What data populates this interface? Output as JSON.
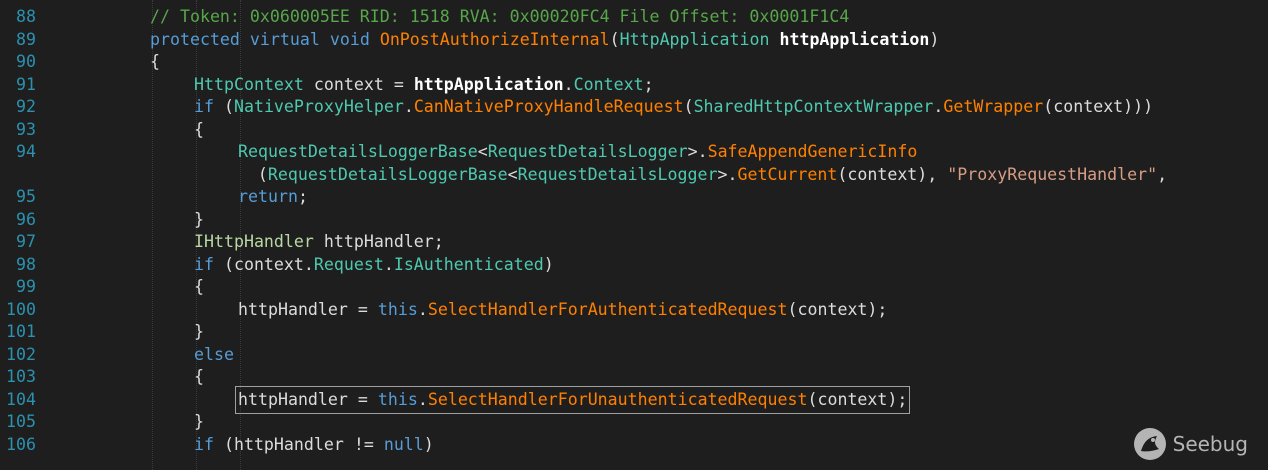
{
  "lines": [
    {
      "num": "88",
      "indent": 3,
      "tokens": [
        {
          "t": "// Token: 0x060005EE RID: 1518 RVA: 0x00020FC4 File Offset: 0x0001F1C4",
          "c": "comment"
        }
      ]
    },
    {
      "num": "89",
      "indent": 3,
      "tokens": [
        {
          "t": "protected",
          "c": "kw"
        },
        {
          "t": " ",
          "c": "plain"
        },
        {
          "t": "virtual",
          "c": "kw"
        },
        {
          "t": " ",
          "c": "plain"
        },
        {
          "t": "void",
          "c": "kw"
        },
        {
          "t": " ",
          "c": "plain"
        },
        {
          "t": "OnPostAuthorizeInternal",
          "c": "method"
        },
        {
          "t": "(",
          "c": "plain"
        },
        {
          "t": "HttpApplication",
          "c": "type"
        },
        {
          "t": " ",
          "c": "plain"
        },
        {
          "t": "httpApplication",
          "c": "bold"
        },
        {
          "t": ")",
          "c": "plain"
        }
      ]
    },
    {
      "num": "90",
      "indent": 3,
      "tokens": [
        {
          "t": "{",
          "c": "plain"
        }
      ]
    },
    {
      "num": "91",
      "indent": 4,
      "tokens": [
        {
          "t": "HttpContext",
          "c": "type"
        },
        {
          "t": " context = ",
          "c": "plain"
        },
        {
          "t": "httpApplication",
          "c": "bold"
        },
        {
          "t": ".",
          "c": "plain"
        },
        {
          "t": "Context",
          "c": "prop"
        },
        {
          "t": ";",
          "c": "plain"
        }
      ]
    },
    {
      "num": "92",
      "indent": 4,
      "tokens": [
        {
          "t": "if",
          "c": "kw"
        },
        {
          "t": " (",
          "c": "plain"
        },
        {
          "t": "NativeProxyHelper",
          "c": "type"
        },
        {
          "t": ".",
          "c": "plain"
        },
        {
          "t": "CanNativeProxyHandleRequest",
          "c": "method"
        },
        {
          "t": "(",
          "c": "plain"
        },
        {
          "t": "SharedHttpContextWrapper",
          "c": "type"
        },
        {
          "t": ".",
          "c": "plain"
        },
        {
          "t": "GetWrapper",
          "c": "method"
        },
        {
          "t": "(context)))",
          "c": "plain"
        }
      ]
    },
    {
      "num": "93",
      "indent": 4,
      "tokens": [
        {
          "t": "{",
          "c": "plain"
        }
      ]
    },
    {
      "num": "94",
      "indent": 5,
      "tokens": [
        {
          "t": "RequestDetailsLoggerBase",
          "c": "type"
        },
        {
          "t": "<",
          "c": "plain"
        },
        {
          "t": "RequestDetailsLogger",
          "c": "type"
        },
        {
          "t": ">.",
          "c": "plain"
        },
        {
          "t": "SafeAppendGenericInfo",
          "c": "method"
        }
      ]
    },
    {
      "num": "",
      "indent": 5,
      "extra": 2,
      "tokens": [
        {
          "t": "(",
          "c": "plain"
        },
        {
          "t": "RequestDetailsLoggerBase",
          "c": "type"
        },
        {
          "t": "<",
          "c": "plain"
        },
        {
          "t": "RequestDetailsLogger",
          "c": "type"
        },
        {
          "t": ">.",
          "c": "plain"
        },
        {
          "t": "GetCurrent",
          "c": "method"
        },
        {
          "t": "(context), ",
          "c": "plain"
        },
        {
          "t": "\"ProxyRequestHandler\"",
          "c": "str"
        },
        {
          "t": ",",
          "c": "plain"
        }
      ]
    },
    {
      "num": "95",
      "indent": 5,
      "tokens": [
        {
          "t": "return",
          "c": "kw"
        },
        {
          "t": ";",
          "c": "plain"
        }
      ]
    },
    {
      "num": "96",
      "indent": 4,
      "tokens": [
        {
          "t": "}",
          "c": "plain"
        }
      ]
    },
    {
      "num": "97",
      "indent": 4,
      "tokens": [
        {
          "t": "IHttpHandler",
          "c": "iface"
        },
        {
          "t": " httpHandler;",
          "c": "plain"
        }
      ]
    },
    {
      "num": "98",
      "indent": 4,
      "tokens": [
        {
          "t": "if",
          "c": "kw"
        },
        {
          "t": " (context.",
          "c": "plain"
        },
        {
          "t": "Request",
          "c": "prop"
        },
        {
          "t": ".",
          "c": "plain"
        },
        {
          "t": "IsAuthenticated",
          "c": "prop"
        },
        {
          "t": ")",
          "c": "plain"
        }
      ]
    },
    {
      "num": "99",
      "indent": 4,
      "tokens": [
        {
          "t": "{",
          "c": "plain"
        }
      ]
    },
    {
      "num": "100",
      "indent": 5,
      "tokens": [
        {
          "t": "httpHandler = ",
          "c": "plain"
        },
        {
          "t": "this",
          "c": "kw"
        },
        {
          "t": ".",
          "c": "plain"
        },
        {
          "t": "SelectHandlerForAuthenticatedRequest",
          "c": "method"
        },
        {
          "t": "(context);",
          "c": "plain"
        }
      ]
    },
    {
      "num": "101",
      "indent": 4,
      "tokens": [
        {
          "t": "}",
          "c": "plain"
        }
      ]
    },
    {
      "num": "102",
      "indent": 4,
      "tokens": [
        {
          "t": "else",
          "c": "kw"
        }
      ]
    },
    {
      "num": "103",
      "indent": 4,
      "tokens": [
        {
          "t": "{",
          "c": "plain"
        }
      ]
    },
    {
      "num": "104",
      "indent": 5,
      "boxed": true,
      "tokens": [
        {
          "t": "httpHandler = ",
          "c": "plain"
        },
        {
          "t": "this",
          "c": "kw"
        },
        {
          "t": ".",
          "c": "plain"
        },
        {
          "t": "SelectHandlerForUnauthenticatedRequest",
          "c": "method"
        },
        {
          "t": "(context);",
          "c": "plain"
        }
      ]
    },
    {
      "num": "105",
      "indent": 4,
      "tokens": [
        {
          "t": "}",
          "c": "plain"
        }
      ]
    },
    {
      "num": "106",
      "indent": 4,
      "tokens": [
        {
          "t": "if",
          "c": "kw"
        },
        {
          "t": " (httpHandler != ",
          "c": "plain"
        },
        {
          "t": "null",
          "c": "kw"
        },
        {
          "t": ")",
          "c": "plain"
        }
      ]
    }
  ],
  "watermark": {
    "text": "Seebug",
    "icon": "seebug-logo-icon"
  }
}
